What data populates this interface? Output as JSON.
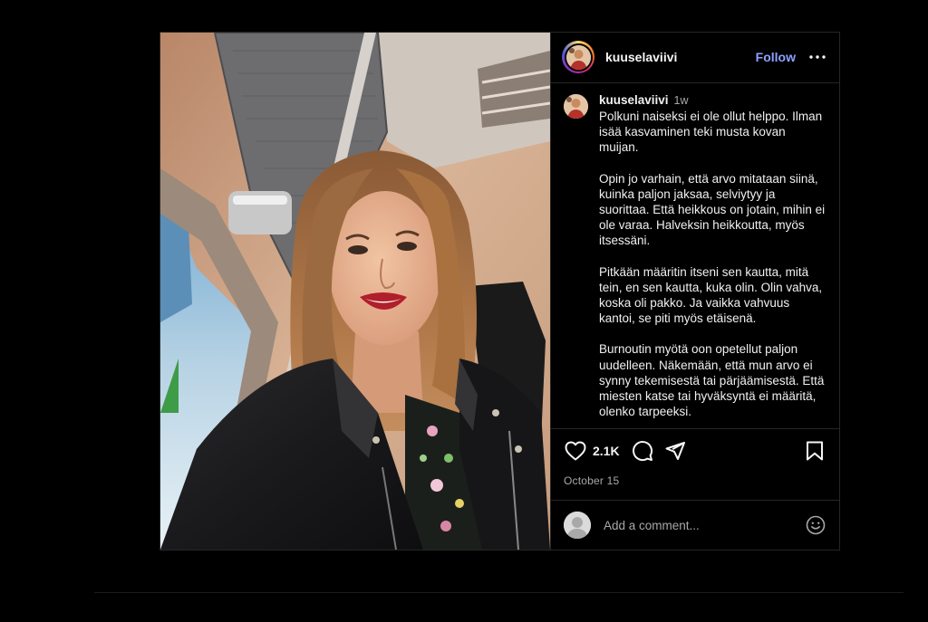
{
  "post": {
    "username": "kuuselaviivi",
    "follow_label": "Follow",
    "caption": {
      "username": "kuuselaviivi",
      "time": "1w",
      "paragraphs": [
        "Polkuni naiseksi ei ole ollut helppo. Ilman isää kasvaminen teki musta kovan muijan.",
        "Opin jo varhain, että arvo mitataan siinä, kuinka paljon jaksaa, selviytyy ja suorittaa. Että heikkous on jotain, mihin ei ole varaa. Halveksin heikkoutta, myös itsessäni.",
        "Pitkään määritin itseni sen kautta, mitä tein, en sen kautta, kuka olin. Olin vahva, koska oli pakko. Ja vaikka vahvuus kantoi, se piti myös etäisenä.",
        "Burnoutin myötä oon opetellut paljon uudelleen. Näkemään, että mun arvo ei synny tekemisestä tai pärjäämisestä. Että miesten katse tai hyväksyntä ei määritä, olenko tarpeeksi."
      ]
    },
    "likes": "2.1K",
    "date": "October 15",
    "comment_placeholder": "Add a comment..."
  },
  "icons": {
    "more": "more-horizontal-icon",
    "like": "heart-icon",
    "comment": "comment-bubble-icon",
    "share": "send-paper-plane-icon",
    "save": "bookmark-icon",
    "emoji": "smiley-icon"
  },
  "colors": {
    "background": "#000000",
    "follow": "#8ea0ff",
    "muted": "#a8a8a8",
    "border": "#262626"
  }
}
